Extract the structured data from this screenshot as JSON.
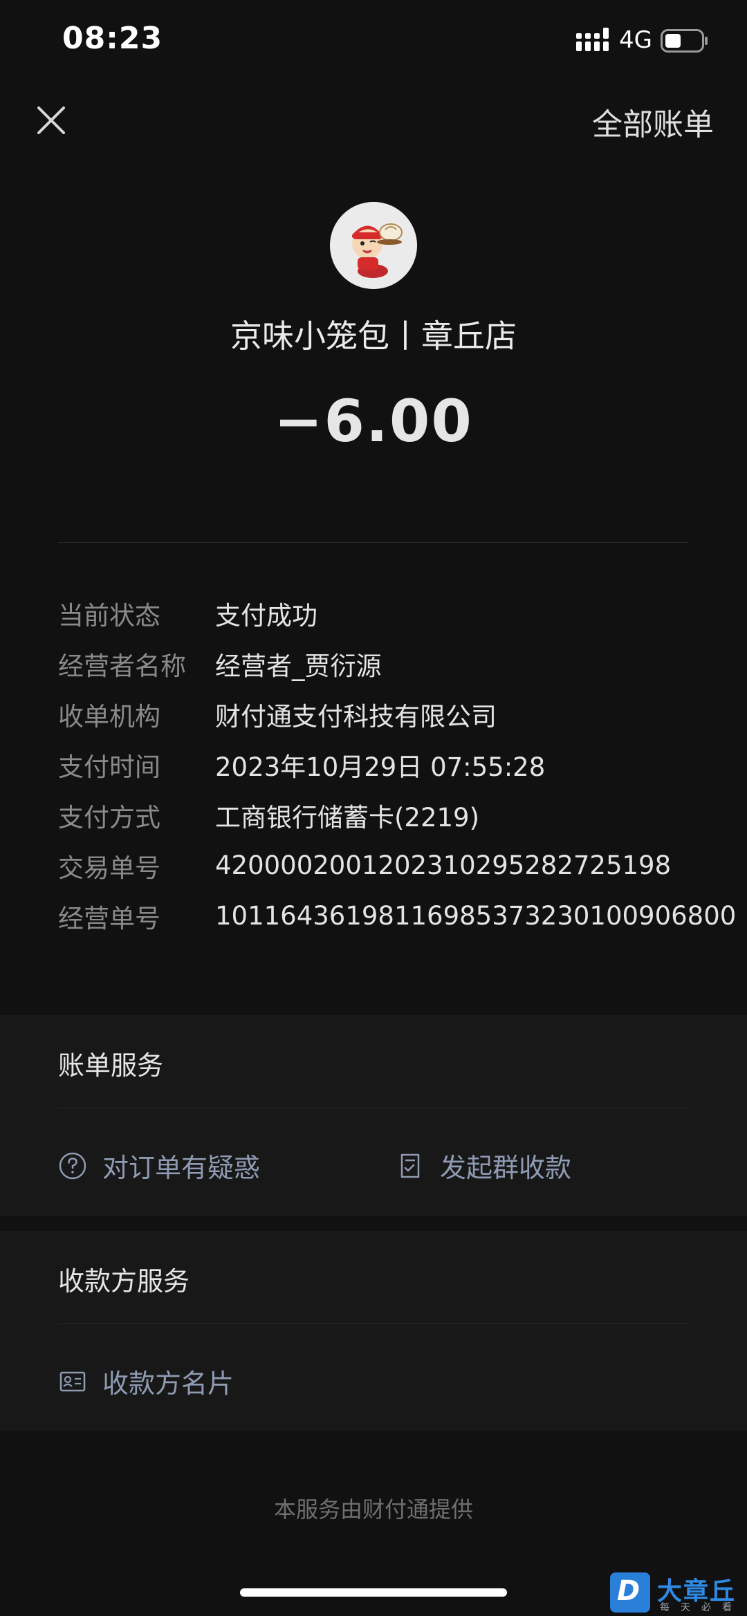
{
  "status_bar": {
    "time": "08:23",
    "network": "4G"
  },
  "nav": {
    "all_bills": "全部账单"
  },
  "merchant": {
    "name": "京味小笼包丨章丘店",
    "amount": "−6.00"
  },
  "details": [
    {
      "label": "当前状态",
      "value": "支付成功"
    },
    {
      "label": "经营者名称",
      "value": "经营者_贾衍源"
    },
    {
      "label": "收单机构",
      "value": "财付通支付科技有限公司"
    },
    {
      "label": "支付时间",
      "value": "2023年10月29日 07:55:28"
    },
    {
      "label": "支付方式",
      "value": "工商银行储蓄卡(2219)"
    },
    {
      "label": "交易单号",
      "value": "4200002001202310295282725198"
    },
    {
      "label": "经营单号",
      "value": "1011643619811698537323010090680​0"
    }
  ],
  "billing_service": {
    "title": "账单服务",
    "question_label": "对订单有疑惑",
    "group_collect_label": "发起群收款"
  },
  "payee_service": {
    "title": "收款方服务",
    "card_label": "收款方名片"
  },
  "footer": "本服务由财付通提供",
  "watermark": {
    "letter": "D",
    "title": "大章丘",
    "subtitle": "每天必看"
  },
  "colors": {
    "background": "#111111",
    "section_background": "#181818",
    "link_blue_gray": "#8f9bb2",
    "watermark_blue": "#2e8ae6"
  }
}
